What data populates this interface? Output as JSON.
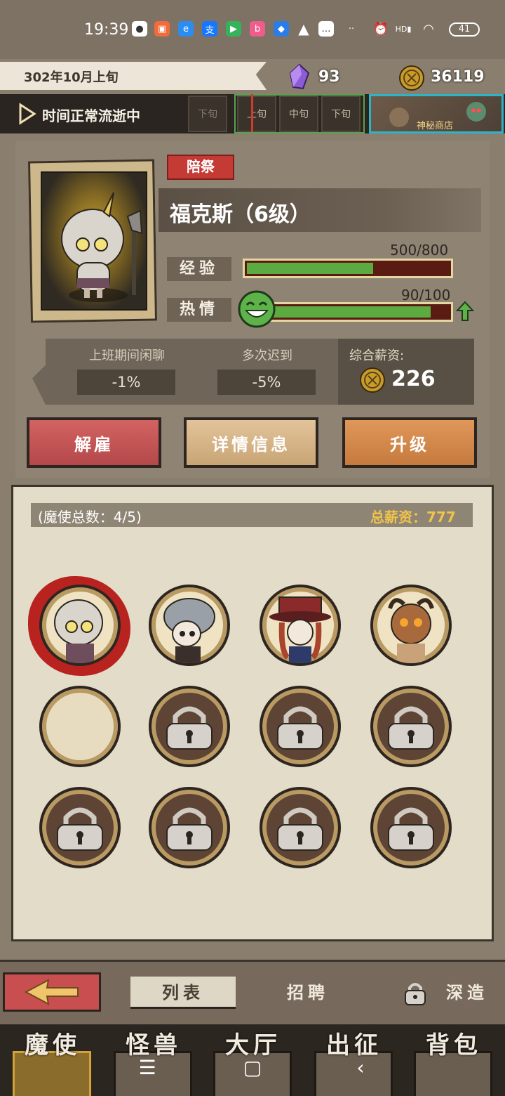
{
  "status_bar": {
    "time": "19:39",
    "battery": "41"
  },
  "header": {
    "date": "302年10月上旬",
    "crystals": "93",
    "gold": "36119",
    "time_status": "时间正常流逝中",
    "timeline": [
      "下旬",
      "上旬",
      "中旬",
      "下旬"
    ],
    "shop_label": "神秘商店"
  },
  "character": {
    "role": "陪祭",
    "name": "福克斯（6级）",
    "exp_label": "经验",
    "exp_value": "500/800",
    "exp_fraction": 0.625,
    "passion_label": "热情",
    "passion_value": "90/100",
    "passion_fraction": 0.9,
    "traits": [
      {
        "title": "上班期间闲聊",
        "value": "-1%"
      },
      {
        "title": "多次迟到",
        "value": "-5%"
      }
    ],
    "salary_title": "综合薪资:",
    "salary_value": "226"
  },
  "actions": {
    "fire": "解雇",
    "detail": "详情信息",
    "upgrade": "升级"
  },
  "roster": {
    "count_label": "(魔使总数：4/5)",
    "total_salary_label": "总薪资：777",
    "slots": [
      "filled",
      "filled",
      "filled",
      "filled",
      "empty",
      "locked",
      "locked",
      "locked",
      "locked",
      "locked",
      "locked",
      "locked"
    ]
  },
  "tabs": {
    "list": "列表",
    "recruit": "招聘",
    "deep": "深造"
  },
  "nav": [
    "魔使",
    "怪兽",
    "大厅",
    "出征",
    "背包"
  ],
  "colors": {
    "exp_bar": "#5cab40",
    "selected_seal": "#b8231f",
    "fire": "#c94e50",
    "upgrade": "#d88c4c"
  }
}
